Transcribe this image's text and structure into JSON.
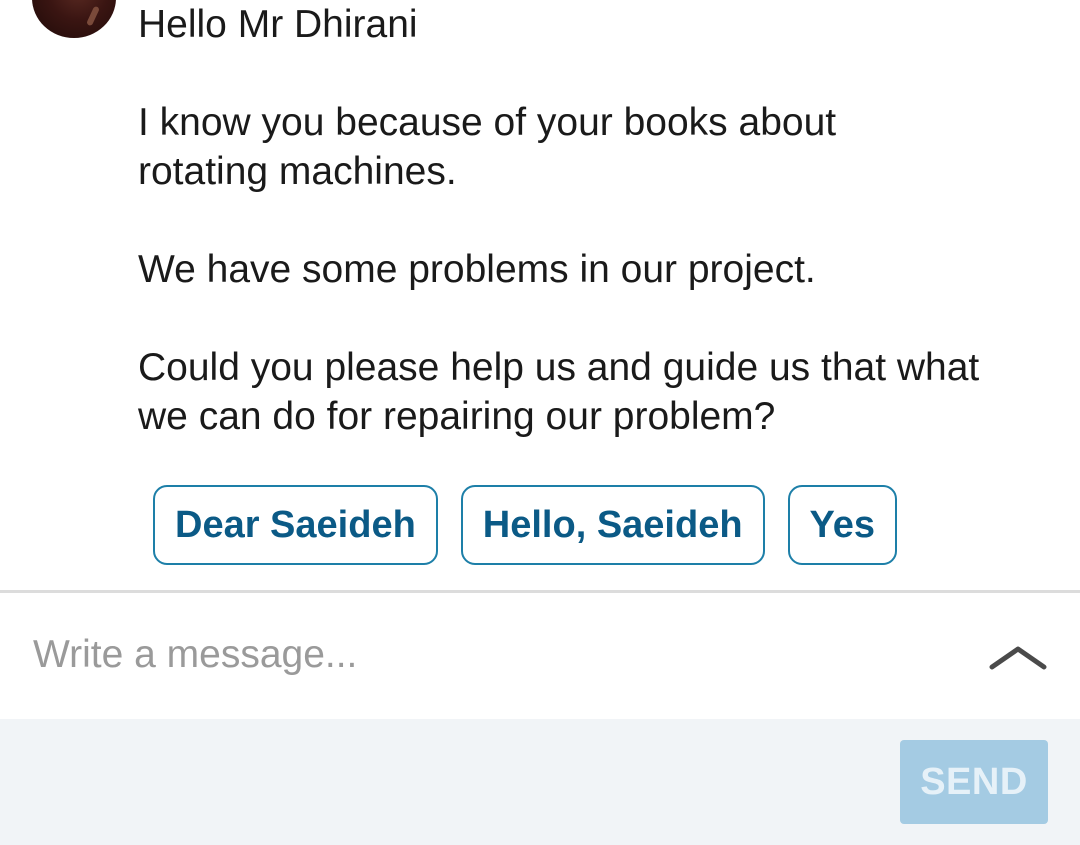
{
  "message": {
    "lines": [
      "Hello Mr Dhirani",
      "I know you because of your books about",
      "rotating machines.",
      "We have some problems in our project.",
      "Could you please help us and guide us that what",
      "we can do for repairing our problem?"
    ]
  },
  "smart_replies": [
    "Dear Saeideh",
    "Hello, Saeideh",
    "Yes"
  ],
  "compose": {
    "placeholder": "Write a message...",
    "value": ""
  },
  "icons": {
    "expand": "chevron-up-icon"
  },
  "footer": {
    "send_label": "SEND"
  },
  "colors": {
    "chip_border": "#1d7fa8",
    "chip_text": "#0b5a86",
    "send_bg_disabled": "#a4cbe3",
    "footer_bg": "#f1f4f7",
    "placeholder": "#9a9a9a"
  }
}
